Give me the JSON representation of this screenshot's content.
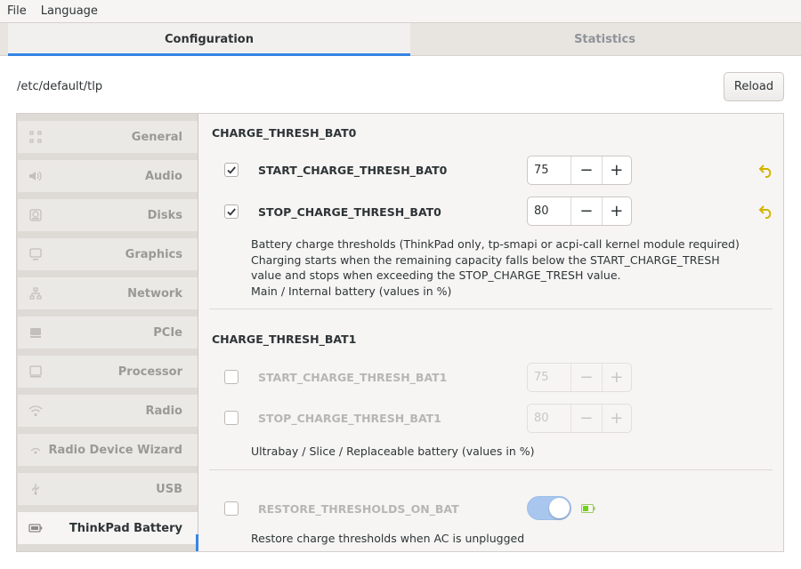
{
  "menubar": {
    "items": [
      "File",
      "Language"
    ]
  },
  "tabs": {
    "configuration": "Configuration",
    "statistics": "Statistics",
    "active": "Configuration"
  },
  "path": "/etc/default/tlp",
  "reload_label": "Reload",
  "sidebar": {
    "items": [
      {
        "label": "General",
        "icon": "general-icon"
      },
      {
        "label": "Audio",
        "icon": "speaker-icon"
      },
      {
        "label": "Disks",
        "icon": "disk-icon"
      },
      {
        "label": "Graphics",
        "icon": "monitor-icon"
      },
      {
        "label": "Network",
        "icon": "network-icon"
      },
      {
        "label": "PCIe",
        "icon": "pcie-icon"
      },
      {
        "label": "Processor",
        "icon": "processor-icon"
      },
      {
        "label": "Radio",
        "icon": "wifi-icon"
      },
      {
        "label": "Radio Device Wizard",
        "icon": "wizard-icon"
      },
      {
        "label": "USB",
        "icon": "usb-icon"
      },
      {
        "label": "ThinkPad Battery",
        "icon": "battery-icon"
      }
    ],
    "active": "ThinkPad Battery"
  },
  "bat0": {
    "title": "CHARGE_THRESH_BAT0",
    "start": {
      "label": "START_CHARGE_THRESH_BAT0",
      "checked": true,
      "value": "75"
    },
    "stop": {
      "label": "STOP_CHARGE_THRESH_BAT0",
      "checked": true,
      "value": "80"
    },
    "description": "Battery charge thresholds (ThinkPad only, tp-smapi or acpi-call kernel module required)\nCharging starts when the remaining capacity falls below the START_CHARGE_TRESH\nvalue and stops when exceeding the STOP_CHARGE_TRESH value.\nMain / Internal battery (values in %)"
  },
  "bat1": {
    "title": "CHARGE_THRESH_BAT1",
    "start": {
      "label": "START_CHARGE_THRESH_BAT1",
      "checked": false,
      "value": "75"
    },
    "stop": {
      "label": "STOP_CHARGE_THRESH_BAT1",
      "checked": false,
      "value": "80"
    },
    "description": "Ultrabay / Slice / Replaceable battery (values in %)"
  },
  "restore": {
    "label": "RESTORE_THRESHOLDS_ON_BAT",
    "checked": false,
    "toggle_on": true,
    "description": "Restore charge thresholds when AC is unplugged"
  },
  "spin_minus": "−",
  "spin_plus": "+",
  "colors": {
    "accent": "#3584e4",
    "undo": "#d4b400",
    "battery": "#73d216"
  }
}
